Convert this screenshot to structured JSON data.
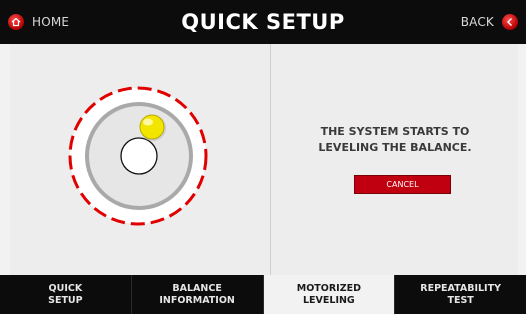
{
  "header": {
    "title": "QUICK SETUP",
    "home_label": "HOME",
    "back_label": "BACK"
  },
  "main": {
    "message": "THE SYSTEM STARTS TO\nLEVELING THE BALANCE.",
    "cancel_label": "CANCEL"
  },
  "nav": {
    "tabs": [
      {
        "label": "QUICK\nSETUP",
        "active": false
      },
      {
        "label": "BALANCE\nINFORMATION",
        "active": false
      },
      {
        "label": "MOTORIZED\nLEVELING",
        "active": true
      },
      {
        "label": "REPEATABILITY\nTEST",
        "active": false
      }
    ]
  },
  "colors": {
    "accent_red": "#c00010",
    "bubble_yellow": "#f2e600",
    "bar_black": "#0c0c0c"
  },
  "icons": {
    "home": "home-icon",
    "back": "back-arrow-icon"
  }
}
